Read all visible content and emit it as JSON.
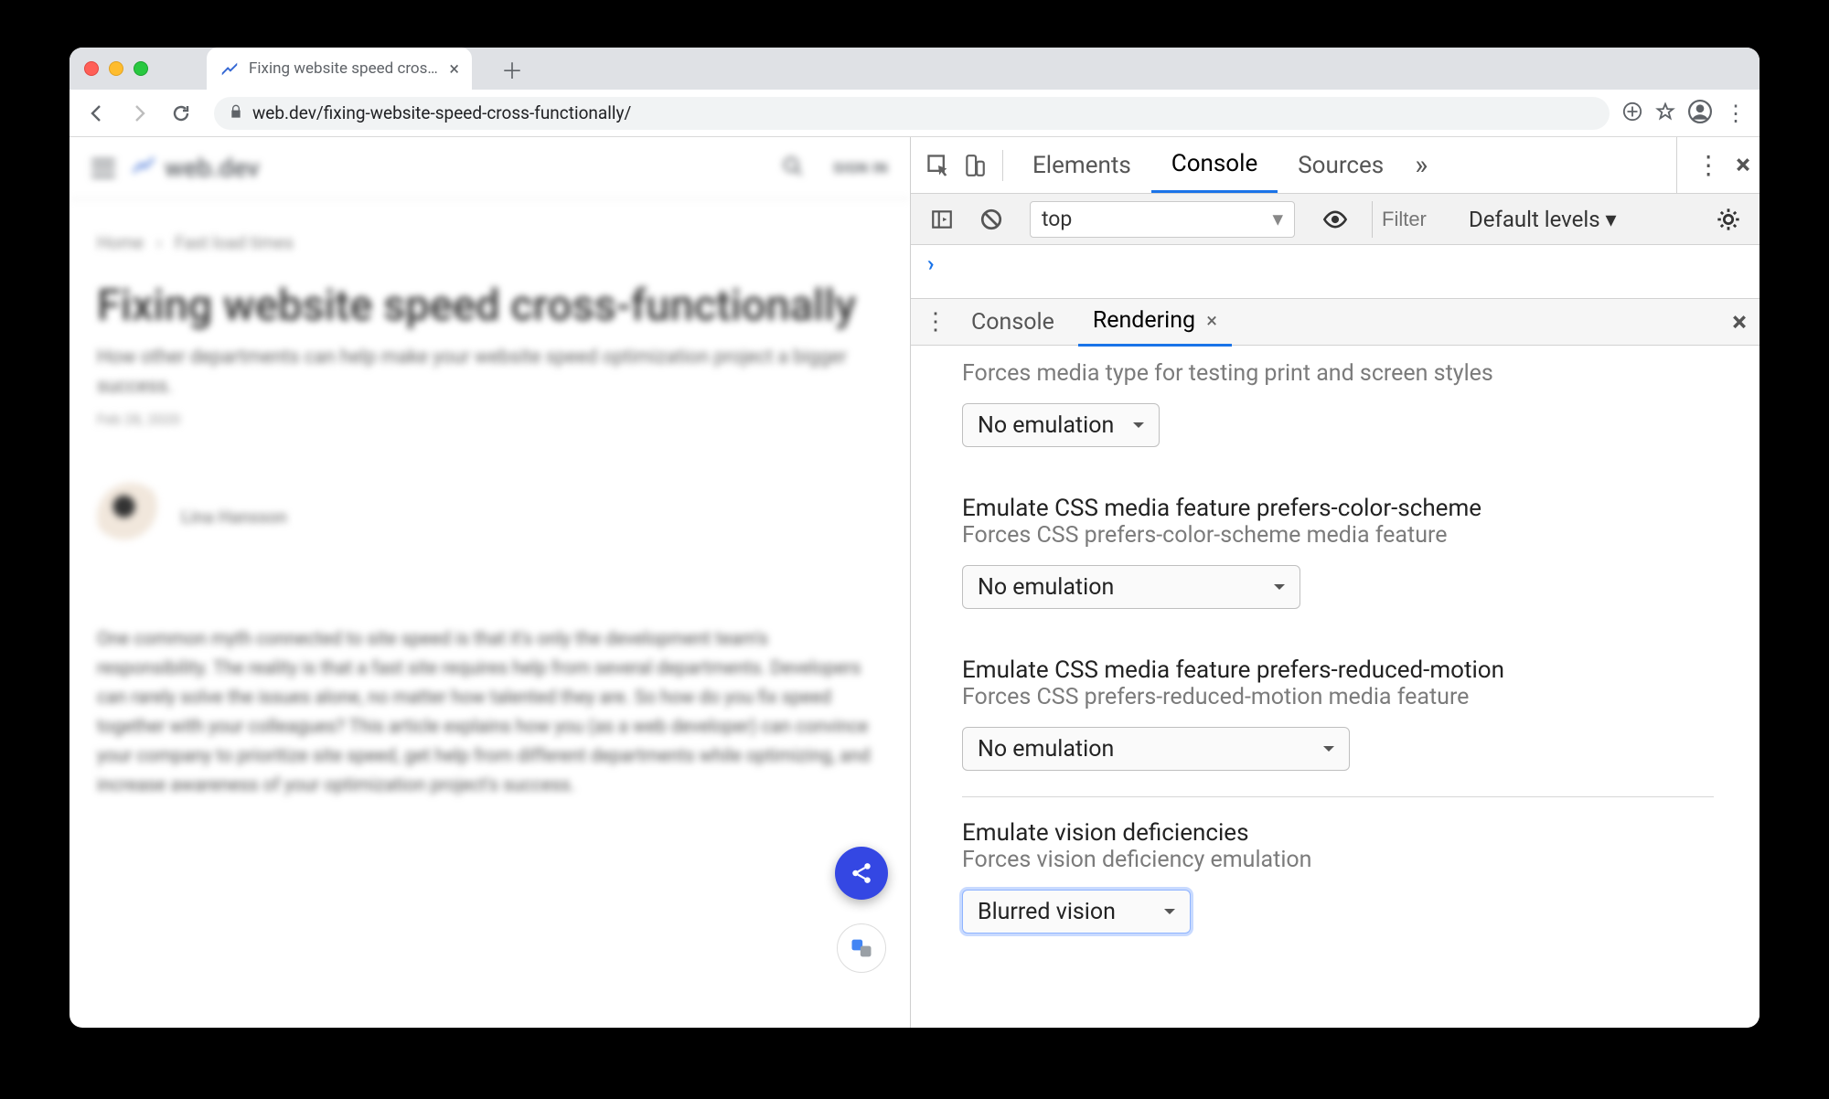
{
  "browser": {
    "tab_title": "Fixing website speed cross-fu",
    "url_host": "web.dev",
    "url_path": "/fixing-website-speed-cross-functionally/",
    "url_display": "web.dev/fixing-website-speed-cross-functionally/"
  },
  "page": {
    "logo_text": "web.dev",
    "signin_label": "SIGN IN",
    "breadcrumb": {
      "root": "Home",
      "sep": "›",
      "leaf": "Fast load times"
    },
    "title": "Fixing website speed cross-functionally",
    "subtitle": "How other departments can help make your website speed optimization project a bigger success.",
    "date": "Feb 28, 2020",
    "author": "Lina Hansson",
    "paragraph": "One common myth connected to site speed is that it's only the development team's responsibility. The reality is that a fast site requires help from several departments. Developers can rarely solve the issues alone, no matter how talented they are. So how do you fix speed together with your colleagues? This article explains how you (as a web developer) can convince your company to prioritize site speed, get help from different departments while optimizing, and increase awareness of your optimization project's success."
  },
  "devtools": {
    "main_tabs": {
      "elements": "Elements",
      "console": "Console",
      "sources": "Sources"
    },
    "console_bar": {
      "context": "top",
      "filter_placeholder": "Filter",
      "levels": "Default levels ▾"
    },
    "drawer_tabs": {
      "console": "Console",
      "rendering": "Rendering"
    },
    "rendering": {
      "media_type": {
        "desc_top": "Forces media type for testing print and screen styles",
        "select_value": "No emulation"
      },
      "color_scheme": {
        "title": "Emulate CSS media feature prefers-color-scheme",
        "desc": "Forces CSS prefers-color-scheme media feature",
        "select_value": "No emulation"
      },
      "reduced_motion": {
        "title": "Emulate CSS media feature prefers-reduced-motion",
        "desc": "Forces CSS prefers-reduced-motion media feature",
        "select_value": "No emulation"
      },
      "vision": {
        "title": "Emulate vision deficiencies",
        "desc": "Forces vision deficiency emulation",
        "select_value": "Blurred vision"
      }
    }
  }
}
